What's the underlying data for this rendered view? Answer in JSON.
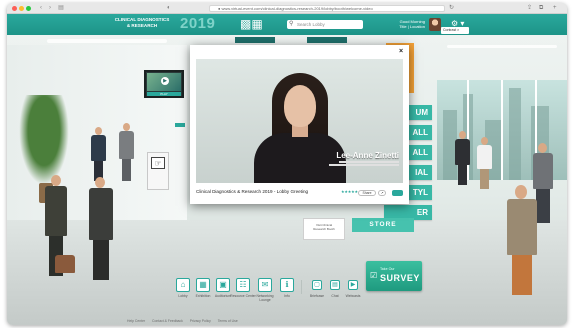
{
  "browser": {
    "url": "● www.virtual-event.com/clinical-diagnostics-research-2019/lobby/booth/welcome-video"
  },
  "header": {
    "brand_line1": "CLINICAL DIAGNOSTICS",
    "brand_line2": "& RESEARCH",
    "brand_year": "2019",
    "search_placeholder": "Search Lobby",
    "greeting_line1": "Good Morning",
    "greeting_line2": "Title | Location",
    "contrast_label": "Contrast ◐",
    "gear_label": "⚙ ▾"
  },
  "scene": {
    "tv_label": "PLAY",
    "booth_buttons": [
      "UM",
      "ALL",
      "ALL",
      "IAL",
      "TYL",
      "ER"
    ],
    "store_label": "STORE",
    "info_box_line1": "Visit Clinical",
    "info_box_line2": "Research Booth",
    "survey_small": "Take Our",
    "survey_big": "SURVEY"
  },
  "toolbar": {
    "items": [
      {
        "label": "Lobby",
        "icon": "home-icon",
        "glyph": "⌂"
      },
      {
        "label": "Exhibition",
        "icon": "exhibit-icon",
        "glyph": "▦"
      },
      {
        "label": "Auditorium",
        "icon": "auditorium-icon",
        "glyph": "▣"
      },
      {
        "label": "Resource Center",
        "icon": "resource-icon",
        "glyph": "☷"
      },
      {
        "label": "Networking Lounge",
        "icon": "chat-icon",
        "glyph": "✉"
      },
      {
        "label": "Info",
        "icon": "info-icon",
        "glyph": "ℹ"
      },
      {
        "label": "Briefcase",
        "icon": "briefcase-icon",
        "glyph": "▢"
      },
      {
        "label": "Chat",
        "icon": "message-icon",
        "glyph": "▤"
      },
      {
        "label": "Webcasts",
        "icon": "webcast-icon",
        "glyph": "▶"
      }
    ]
  },
  "footer": {
    "links": [
      "Help Center",
      "Contact & Feedback",
      "Privacy Policy",
      "Terms of Use"
    ]
  },
  "modal": {
    "close_label": "×",
    "speaker_name": "Lee-Anne Zinetti",
    "title": "Clinical Diagnostics & Research 2019 - Lobby Greeting",
    "stars": "★★★★★",
    "share_label": "Share",
    "copy_label": "↗"
  },
  "colors": {
    "brand_teal": "#2aa89c",
    "accent_orange": "#f4a238",
    "survey_green": "#3bbf9f"
  }
}
